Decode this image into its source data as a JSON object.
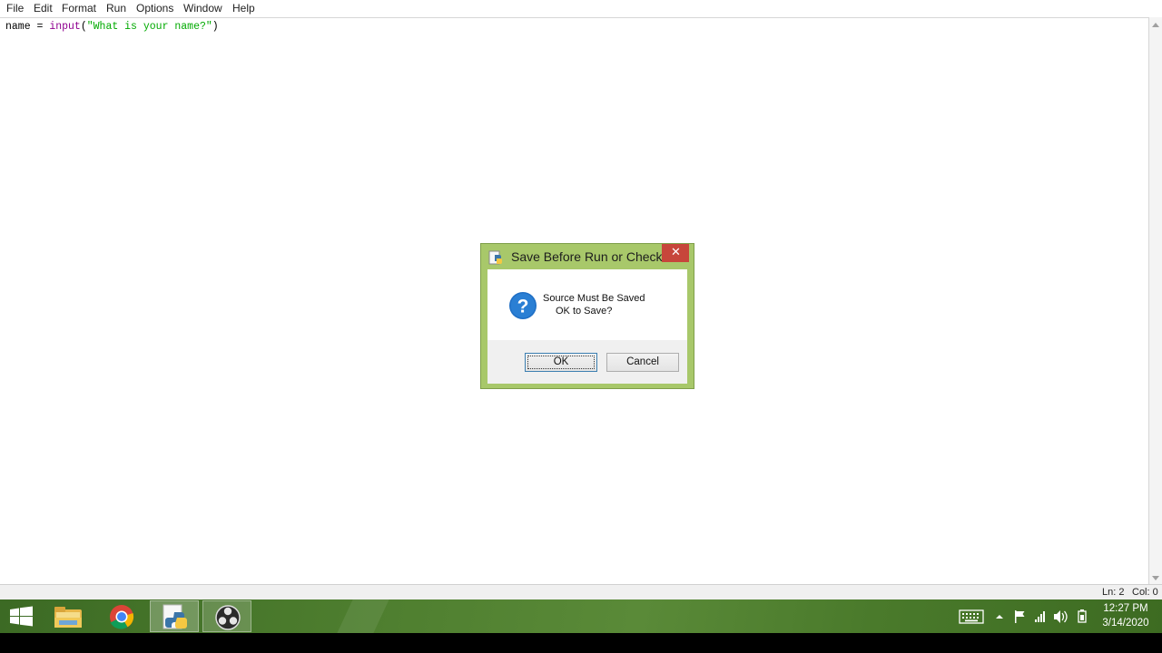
{
  "menu": [
    "File",
    "Edit",
    "Format",
    "Run",
    "Options",
    "Window",
    "Help"
  ],
  "editor": {
    "line1": {
      "var": "name",
      "op": " = ",
      "builtin": "input",
      "open": "(",
      "string": "\"What is your name?\"",
      "close": ")"
    }
  },
  "status": {
    "line": "Ln: 2",
    "col": "Col: 0"
  },
  "dialog": {
    "title": "Save Before Run or Check",
    "close_glyph": "✕",
    "message_line1": "Source Must Be Saved",
    "message_line2": "OK to Save?",
    "icon_glyph": "?",
    "ok_label": "OK",
    "cancel_label": "Cancel"
  },
  "tray": {
    "time": "12:27 PM",
    "date": "3/14/2020"
  },
  "colors": {
    "taskbar": "#4d7d2e",
    "dialog_frame": "#a8c86a",
    "close": "#c7463b"
  }
}
